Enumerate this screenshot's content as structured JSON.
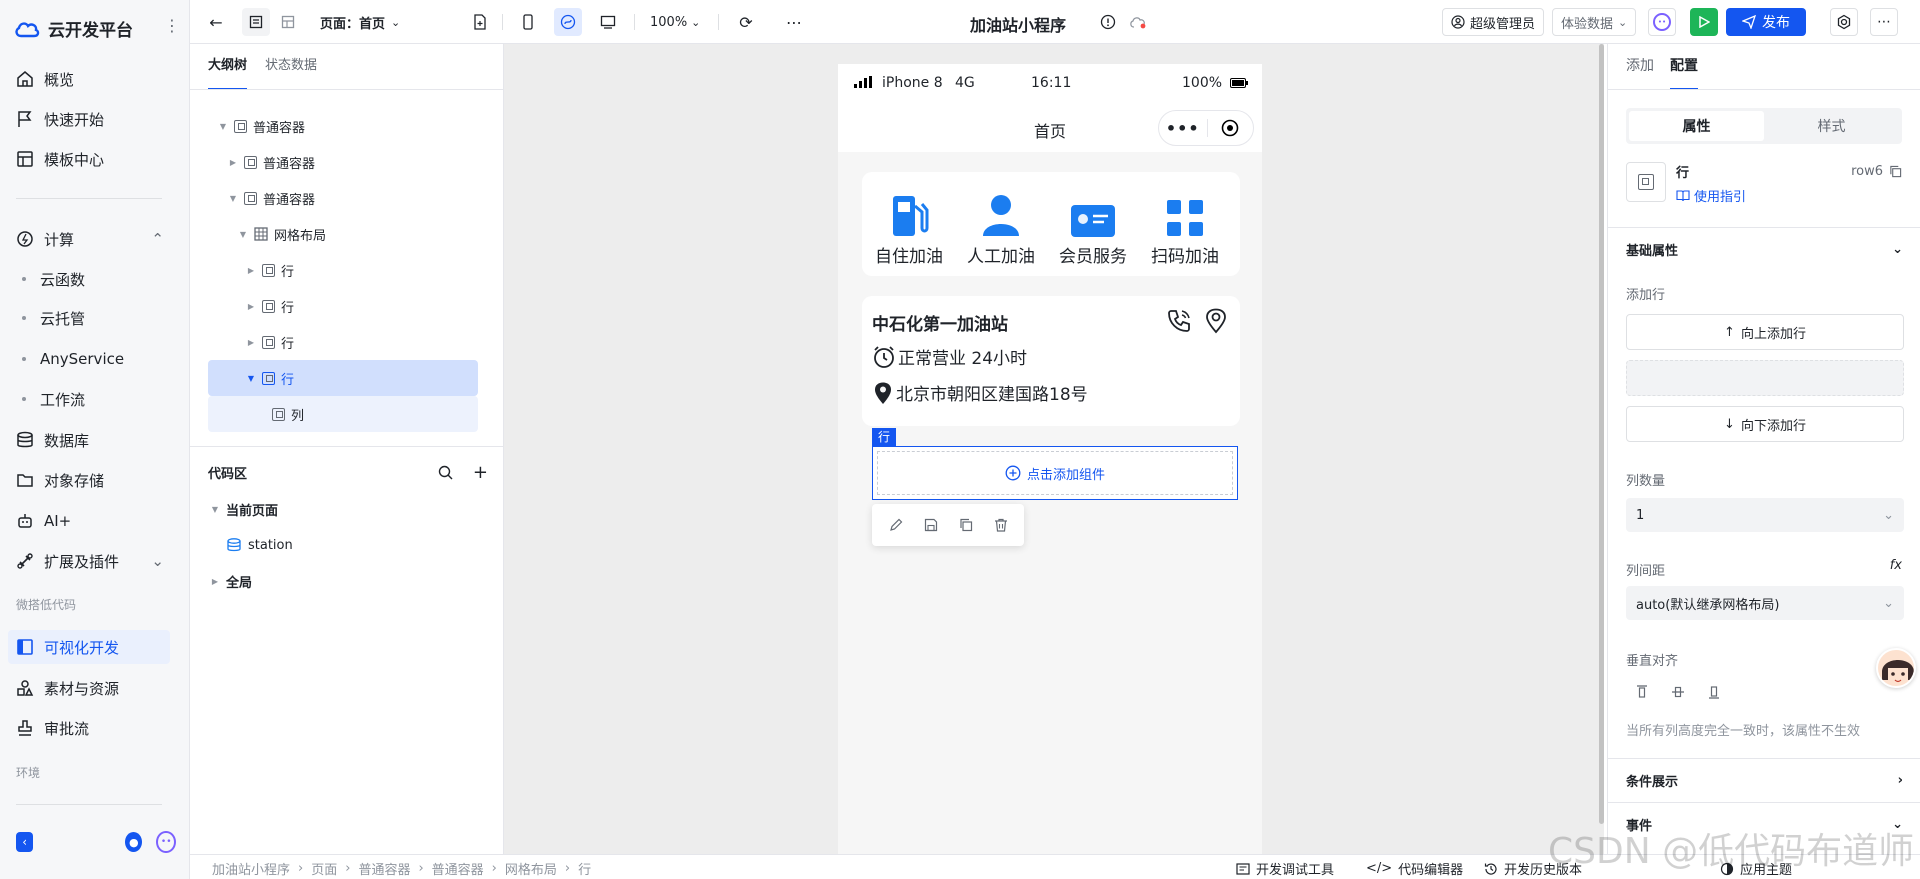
{
  "app": {
    "name": "云开发平台"
  },
  "sidebar": {
    "items": [
      {
        "label": "概览",
        "icon": "home-icon"
      },
      {
        "label": "快速开始",
        "icon": "flag-icon"
      },
      {
        "label": "模板中心",
        "icon": "template-icon"
      },
      {
        "label": "计算",
        "icon": "compute-icon"
      },
      {
        "label": "云函数"
      },
      {
        "label": "云托管"
      },
      {
        "label": "AnyService"
      },
      {
        "label": "工作流"
      },
      {
        "label": "数据库",
        "icon": "database-icon"
      },
      {
        "label": "对象存储",
        "icon": "folder-icon"
      },
      {
        "label": "AI+",
        "icon": "robot-icon"
      },
      {
        "label": "扩展及插件",
        "icon": "plugin-icon"
      },
      {
        "label": "可视化开发",
        "icon": "visual-dev-icon"
      },
      {
        "label": "素材与资源",
        "icon": "assets-icon"
      },
      {
        "label": "审批流",
        "icon": "approval-icon"
      }
    ],
    "section_lowcode": "微搭低代码",
    "section_env": "环境"
  },
  "toolbar": {
    "page_label": "页面：首页",
    "zoom": "100%",
    "title": "加油站小程序",
    "user_role": "超级管理员",
    "data_mode": "体验数据",
    "publish_label": "发布"
  },
  "outline": {
    "tabs": [
      "大纲树",
      "状态数据"
    ],
    "tree": [
      {
        "label": "普通容器"
      },
      {
        "label": "普通容器"
      },
      {
        "label": "普通容器"
      },
      {
        "label": "网格布局"
      },
      {
        "label": "行"
      },
      {
        "label": "行"
      },
      {
        "label": "行"
      },
      {
        "label": "行"
      },
      {
        "label": "列"
      }
    ],
    "code_title": "代码区",
    "code_current_page": "当前页面",
    "code_station": "station",
    "code_global": "全局"
  },
  "phone": {
    "carrier": "iPhone 8",
    "network": "4G",
    "time": "16:11",
    "battery": "100%",
    "nav_title": "首页",
    "grid": [
      "自住加油",
      "人工加油",
      "会员服务",
      "扫码加油"
    ],
    "station_name": "中石化第一加油站",
    "hours": "正常营业 24小时",
    "address": "北京市朝阳区建国路18号",
    "selected_tag": "行",
    "add_component": "点击添加组件"
  },
  "props": {
    "tabs": [
      "添加",
      "配置"
    ],
    "segments": [
      "属性",
      "样式"
    ],
    "component_name": "行",
    "component_id": "row6",
    "usage_guide": "使用指引",
    "basic_props": "基础属性",
    "add_row_label": "添加行",
    "add_row_above": "向上添加行",
    "add_row_below": "向下添加行",
    "columns_label": "列数量",
    "columns_value": "1",
    "gap_label": "列间距",
    "fx": "fx",
    "gap_value": "auto(默认继承网格布局)",
    "valign_label": "垂直对齐",
    "valign_note": "当所有列高度完全一致时，该属性不生效",
    "cond_display": "条件展示",
    "events": "事件"
  },
  "bottombar": {
    "breadcrumb": [
      "加油站小程序",
      "页面",
      "普通容器",
      "普通容器",
      "网格布局",
      "行"
    ],
    "tools": [
      "开发调试工具",
      "代码编辑器",
      "开发历史版本",
      "应用主题"
    ]
  },
  "watermark": "CSDN @低代码布道师",
  "colors": {
    "accent": "#1456f0",
    "run": "#1db558",
    "icon_blue": "#1b7df0"
  }
}
